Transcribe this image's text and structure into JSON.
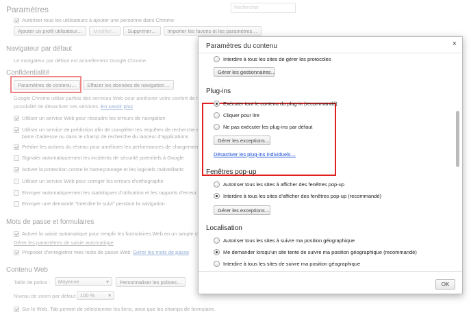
{
  "settings": {
    "title": "Paramètres",
    "search_placeholder": "Rechercher",
    "users": {
      "allow_add_label": "Autoriser tous les utilisateurs à ajouter une personne dans Chrome",
      "buttons": [
        "Ajouter un profil utilisateur…",
        "Modifier…",
        "Supprimer…",
        "Importer les favoris et les paramètres…"
      ]
    },
    "default_browser": {
      "heading": "Navigateur par défaut",
      "text": "Le navigateur par défaut est actuellement Google Chrome."
    },
    "privacy": {
      "heading": "Confidentialité",
      "content_settings_button": "Paramètres de contenu…",
      "clear_data_button": "Effacer les données de navigation…",
      "desc_line1": "Google Chrome utilise parfois des services Web pour améliorer votre confort de navigation. Vous avez la",
      "desc_line2": "possibilité de désactiver ces services.",
      "learn_more": "En savoir plus",
      "options": [
        {
          "label": "Utiliser un service Web pour résoudre les erreurs de navigation",
          "checked": true
        },
        {
          "label": "Utiliser un service de prédiction afin de compléter les requêtes de recherche et les URL saisies dans la",
          "checked": true
        },
        {
          "label": "barre d'adresse ou dans le champ de recherche du lanceur d'applications",
          "checked": null
        },
        {
          "label": "Prédire les actions du réseau pour améliorer les performances de chargement des pages",
          "checked": true
        },
        {
          "label": "Signaler automatiquement les incidents de sécurité potentiels à Google",
          "checked": false
        },
        {
          "label": "Activer la protection contre le hameçonnage et les logiciels malveillants",
          "checked": true
        },
        {
          "label": "Utiliser un service Web pour corriger les erreurs d'orthographe",
          "checked": false
        },
        {
          "label": "Envoyer automatiquement les statistiques d'utilisation et les rapports d'erreur à Google",
          "checked": false
        },
        {
          "label": "Envoyer une demande \"Interdire le suivi\" pendant la navigation",
          "checked": false
        }
      ]
    },
    "passwords": {
      "heading": "Mots de passe et formulaires",
      "autofill_label": "Activer la saisie automatique pour remplir les formulaires Web en un simple clic",
      "autofill_link": "Gérer les paramètres de saisie automatique",
      "save_pw_label": "Proposer d'enregistrer mes mots de passe Web",
      "save_pw_link": "Gérer les mots de passe"
    },
    "web_content": {
      "heading": "Contenu Web",
      "font_size_label": "Taille de police :",
      "font_size_value": "Moyenne",
      "customize_fonts": "Personnaliser les polices…",
      "zoom_label": "Niveau de zoom par défaut :",
      "zoom_value": "100 %",
      "tab_text": "Sur le Web, Tab permet de sélectionner les liens, ainsi que les champs de formulaire."
    }
  },
  "dialog": {
    "title": "Paramètres du contenu",
    "close": "×",
    "protocols": {
      "option": "Interdire à tous les sites de gérer les protocoles",
      "button": "Gérer les gestionnaires…"
    },
    "plugins": {
      "heading": "Plug-ins",
      "options": [
        {
          "label": "Exécuter tout le contenu du plug-in (recommandé)",
          "selected": true
        },
        {
          "label": "Cliquer pour lire",
          "selected": false
        },
        {
          "label": "Ne pas exécuter les plug-ins par défaut",
          "selected": false
        }
      ],
      "button": "Gérer les exceptions…",
      "link": "Désactiver les plug-ins individuels…"
    },
    "popups": {
      "heading": "Fenêtres pop-up",
      "options": [
        {
          "label": "Autoriser tous les sites à afficher des fenêtres pop-up",
          "selected": false
        },
        {
          "label": "Interdire à tous les sites d'afficher des fenêtres pop-up (recommandé)",
          "selected": true
        }
      ],
      "button": "Gérer les exceptions…"
    },
    "location": {
      "heading": "Localisation",
      "options": [
        {
          "label": "Autoriser tous les sites à suivre ma position géographique",
          "selected": false
        },
        {
          "label": "Me demander lorsqu'un site tente de suivre ma position géographique (recommandé)",
          "selected": true
        },
        {
          "label": "Interdire à tous les sites de suivre ma position géographique",
          "selected": false
        }
      ]
    },
    "ok_button": "OK"
  }
}
